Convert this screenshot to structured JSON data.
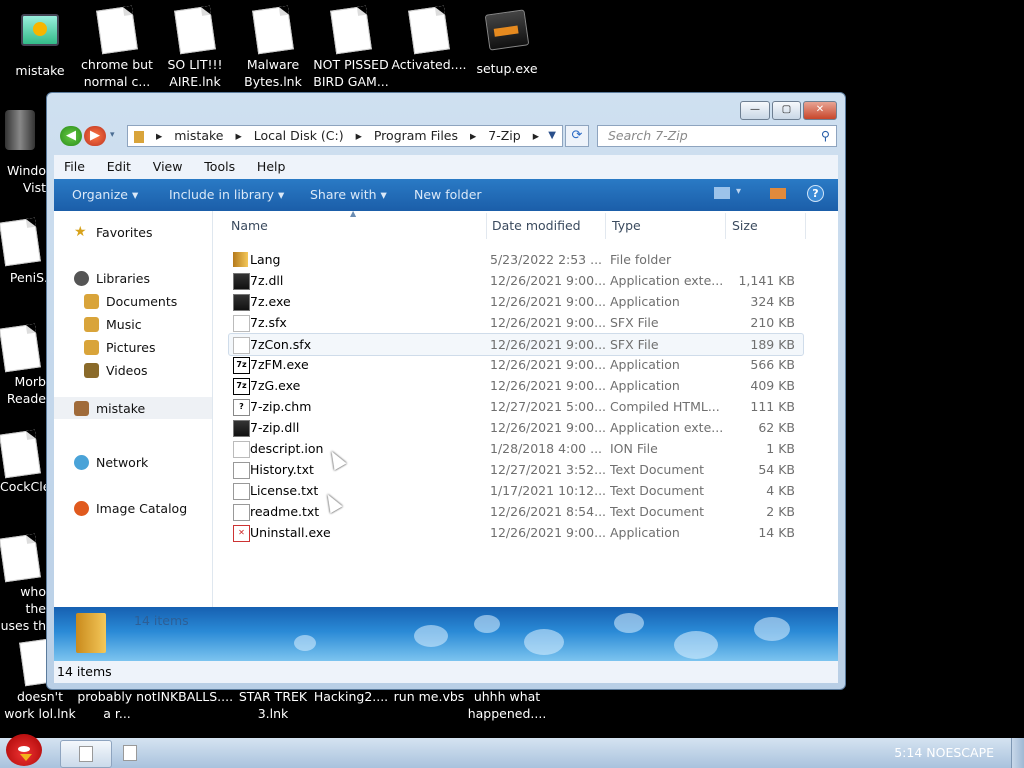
{
  "desktop": {
    "top_icons": [
      "mistake",
      "chrome but normal c...",
      "SO LIT!!! AIRE.lnk",
      "Malware Bytes.lnk",
      "NOT PISSED BIRD GAM...",
      "Activated....",
      "setup.exe"
    ],
    "left_icons": [
      "Windo Vist",
      "PeniS.",
      "Morb Reade",
      "CockCle",
      "who the uses th",
      "doesn't work lol.lnk"
    ],
    "bottom_icons": [
      "probably not a r...",
      "INKBALLS....",
      "STAR TREK 3.lnk",
      "Hacking2....",
      "run me.vbs",
      "uhhh what happened...."
    ]
  },
  "window": {
    "caption": {
      "min": "—",
      "max": "▢",
      "close": "✕"
    },
    "breadcrumb": [
      "mistake",
      "Local Disk (C:)",
      "Program Files",
      "7-Zip"
    ],
    "search_placeholder": "Search 7-Zip",
    "menu": [
      "File",
      "Edit",
      "View",
      "Tools",
      "Help"
    ],
    "toolbar": {
      "organize": "Organize ▾",
      "include": "Include in library ▾",
      "share": "Share with ▾",
      "new_folder": "New folder"
    },
    "nav": {
      "favorites": "Favorites",
      "libraries": "Libraries",
      "documents": "Documents",
      "music": "Music",
      "pictures": "Pictures",
      "videos": "Videos",
      "mistake": "mistake",
      "network": "Network",
      "image_catalog": "Image Catalog"
    },
    "columns": {
      "name": "Name",
      "date": "Date modified",
      "type": "Type",
      "size": "Size"
    },
    "files": [
      {
        "name": "Lang",
        "date": "5/23/2022 2:53 ...",
        "type": "File folder",
        "size": "",
        "icon": "folder-icon"
      },
      {
        "name": "7z.dll",
        "date": "12/26/2021 9:00...",
        "type": "Application exte...",
        "size": "1,141 KB",
        "icon": "dll-icon"
      },
      {
        "name": "7z.exe",
        "date": "12/26/2021 9:00...",
        "type": "Application",
        "size": "324 KB",
        "icon": "exe-icon"
      },
      {
        "name": "7z.sfx",
        "date": "12/26/2021 9:00...",
        "type": "SFX File",
        "size": "210 KB",
        "icon": "file-icon"
      },
      {
        "name": "7zCon.sfx",
        "date": "12/26/2021 9:00...",
        "type": "SFX File",
        "size": "189 KB",
        "icon": "file-icon"
      },
      {
        "name": "7zFM.exe",
        "date": "12/26/2021 9:00...",
        "type": "Application",
        "size": "566 KB",
        "icon": "7z-icon"
      },
      {
        "name": "7zG.exe",
        "date": "12/26/2021 9:00...",
        "type": "Application",
        "size": "409 KB",
        "icon": "7z-icon"
      },
      {
        "name": "7-zip.chm",
        "date": "12/27/2021 5:00...",
        "type": "Compiled HTML...",
        "size": "111 KB",
        "icon": "help-icon"
      },
      {
        "name": "7-zip.dll",
        "date": "12/26/2021 9:00...",
        "type": "Application exte...",
        "size": "62 KB",
        "icon": "dll-icon"
      },
      {
        "name": "descript.ion",
        "date": "1/28/2018 4:00 ...",
        "type": "ION File",
        "size": "1 KB",
        "icon": "file-icon"
      },
      {
        "name": "History.txt",
        "date": "12/27/2021 3:52...",
        "type": "Text Document",
        "size": "54 KB",
        "icon": "text-icon"
      },
      {
        "name": "License.txt",
        "date": "1/17/2021 10:12...",
        "type": "Text Document",
        "size": "4 KB",
        "icon": "text-icon"
      },
      {
        "name": "readme.txt",
        "date": "12/26/2021 8:54...",
        "type": "Text Document",
        "size": "2 KB",
        "icon": "text-icon"
      },
      {
        "name": "Uninstall.exe",
        "date": "12/26/2021 9:00...",
        "type": "Application",
        "size": "14 KB",
        "icon": "uninstall-icon"
      }
    ],
    "details_count": "14 items",
    "status_count": "14 items"
  },
  "taskbar": {
    "clock": "5:14 NOESCAPE"
  }
}
